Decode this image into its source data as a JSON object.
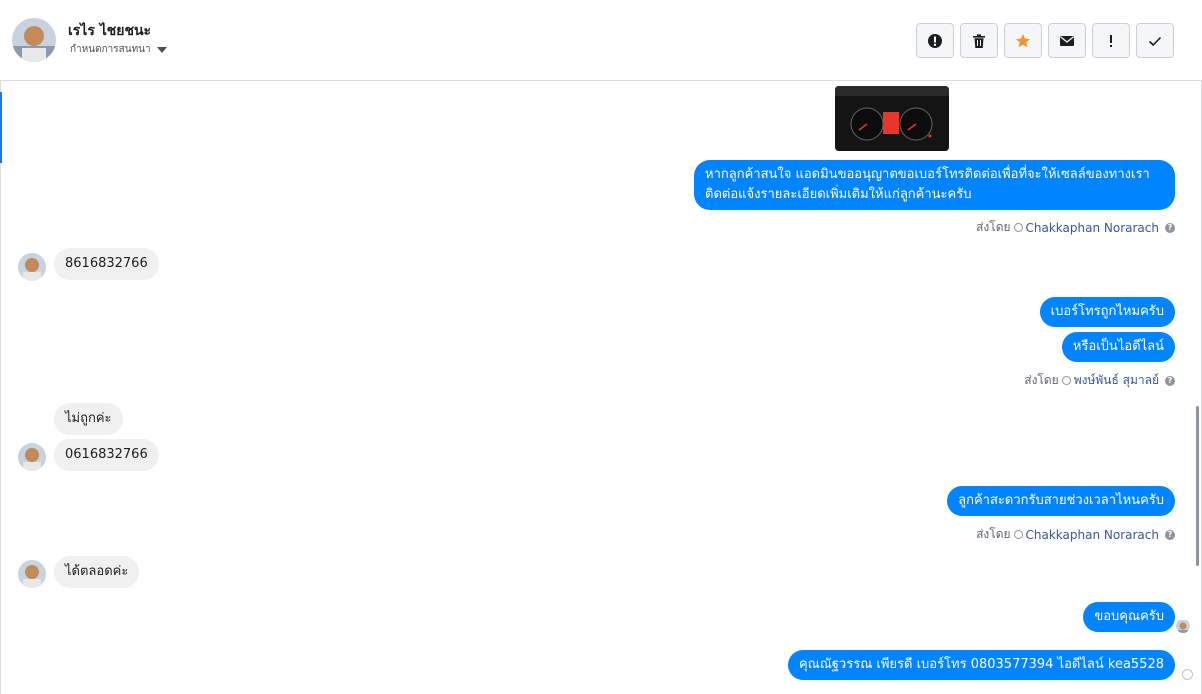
{
  "header": {
    "contact_name": "เรไร ไชยชนะ",
    "contact_subtitle": "กำหนดการสนทนา",
    "toolbar": [
      {
        "id": "spam",
        "icon": "alert-circle-icon"
      },
      {
        "id": "delete",
        "icon": "trash-icon"
      },
      {
        "id": "star",
        "icon": "star-icon"
      },
      {
        "id": "mark-unread",
        "icon": "envelope-icon"
      },
      {
        "id": "important",
        "icon": "exclamation-icon"
      },
      {
        "id": "done",
        "icon": "checkmark-icon"
      }
    ]
  },
  "colors": {
    "outgoing_bubble": "#0084ff",
    "incoming_bubble": "#f1f0f0",
    "star": "#f7923b",
    "sender_name": "#385898"
  },
  "messages": {
    "m1_line1": "หากลูกค้าสนใจ แอดมินขออนุญาตขอเบอร์โทรติดต่อเพื่อที่จะให้เซลล์ของทางเรา",
    "m1_line2": "ติดต่อแจ้งรายละเอียดเพิ่มเติมให้แก่ลูกค้านะครับ",
    "m2": "8616832766",
    "m3": "เบอร์โทรถูกไหมครับ",
    "m4": "หรือเป็นไอดีไลน์",
    "m5": "ไม่ถูกค่ะ",
    "m6": "0616832766",
    "m7": "ลูกค้าสะดวกรับสายช่วงเวลาไหนครับ",
    "m8": "ได้ตลอดค่ะ",
    "m9": "ขอบคุณครับ",
    "m10": "คุณณัฐวรรณ เพียรดี        เบอร์โทร 0803577394  ไอดีไลน์ kea5528"
  },
  "sent_by": {
    "prefix": "ส่งโดย",
    "s1": "Chakkaphan Norarach",
    "s2": "พงษ์พันธ์ สุมาลย์",
    "s3": "Chakkaphan Norarach"
  }
}
